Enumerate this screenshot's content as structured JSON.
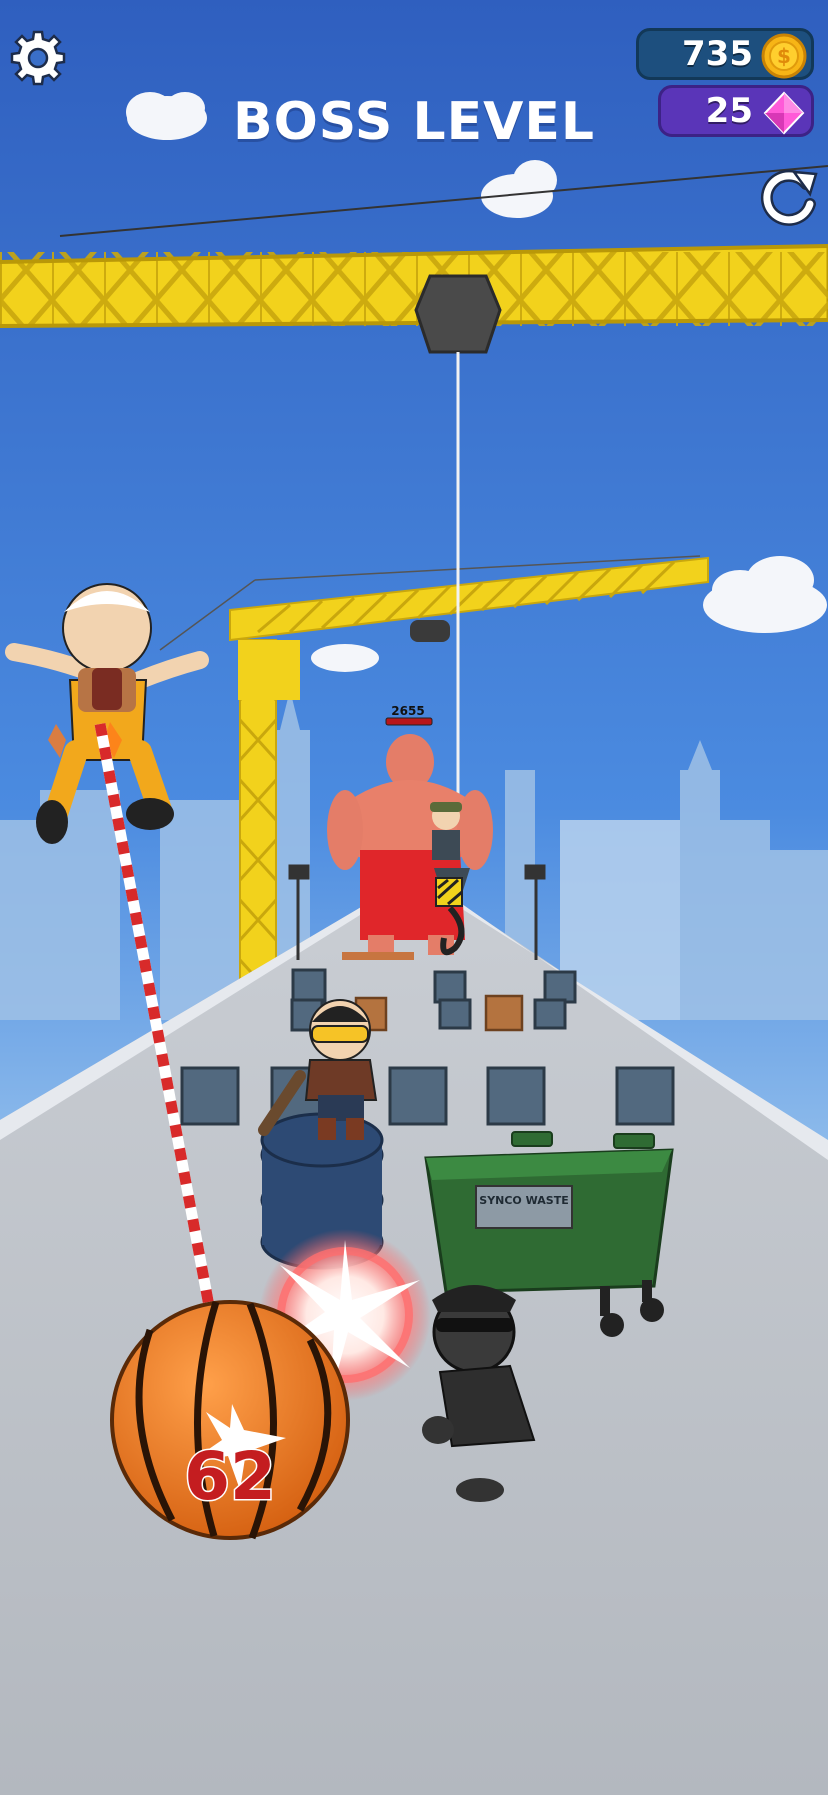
{
  "hud": {
    "title": "BOSS LEVEL",
    "coins": "735",
    "gems": "25",
    "settings_icon": "gear-icon",
    "reload_icon": "restart-icon",
    "coin_icon": "coin-icon",
    "gem_icon": "diamond-icon"
  },
  "boss": {
    "hp": "2655"
  },
  "player": {
    "ball_count": "62"
  },
  "props": {
    "dumpster_label": "SYNCO WASTE"
  },
  "colors": {
    "sky": "#3a6fc9",
    "crane": "#f2d21c",
    "coin_badge": "#1d4f7e",
    "gem_badge": "#5a35b8",
    "ball": "#ef7a1c",
    "boss_skin": "#e8806a",
    "boss_shorts": "#e0262a"
  }
}
